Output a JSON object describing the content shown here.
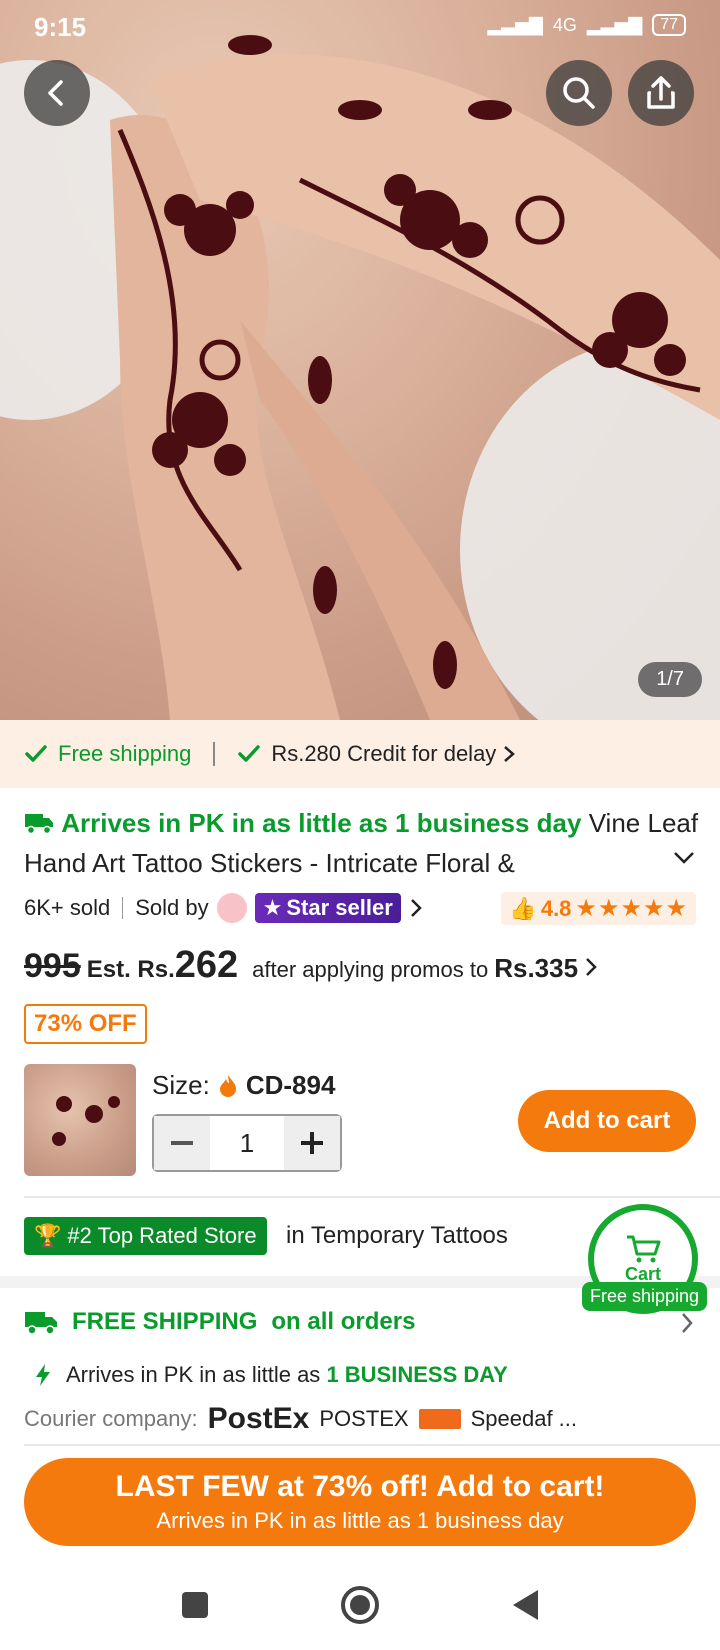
{
  "status_bar": {
    "time": "9:15",
    "battery": "77",
    "network_label": "4G"
  },
  "gallery": {
    "counter": "1/7"
  },
  "icons": {
    "back": "back-arrow-icon",
    "search": "search-icon",
    "share": "share-icon"
  },
  "shipping_banner": {
    "free_shipping": "Free shipping",
    "credit": "Rs.280 Credit for delay"
  },
  "product": {
    "arrives": "Arrives in PK in as little as 1 business day",
    "title": "Vine Leaf Hand Art Tattoo Stickers - Intricate Floral &",
    "sold": "6K+ sold",
    "sold_by": "Sold by",
    "star_seller": "Star seller",
    "rating": "4.8",
    "stars": "★★★★★",
    "old_price": "995",
    "est_label": "Est. Rs.",
    "price": "262",
    "promo_text": "after applying promos to",
    "promo_price": "Rs.335",
    "discount_badge": "73% OFF",
    "size_label": "Size:",
    "size_value": "CD-894",
    "quantity": "1",
    "add_to_cart": "Add to cart"
  },
  "store": {
    "badge": "#2 Top Rated Store",
    "category": "in Temporary Tattoos"
  },
  "cart_float": {
    "label": "Cart",
    "free_shipping": "Free shipping"
  },
  "shipping_info": {
    "title_bold": "FREE SHIPPING",
    "title_rest": "on all orders",
    "arrives_prefix": "Arrives in PK in as little as",
    "arrives_highlight": "1 BUSINESS DAY",
    "courier_label": "Courier company:",
    "courier1_logo": "PostEx",
    "courier1": "POSTEX",
    "courier2": "Speedaf ..."
  },
  "cta": {
    "main": "LAST FEW at 73% off! Add to cart!",
    "sub": "Arrives in PK in as little as 1 business day"
  },
  "colors": {
    "accent": "#f57a0e",
    "green": "#0a9b2d",
    "star_seller": "#5a24a8"
  }
}
